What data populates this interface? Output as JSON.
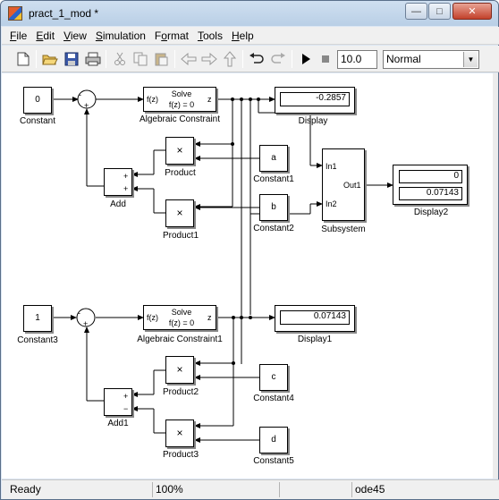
{
  "window": {
    "title": "pract_1_mod *",
    "minimize": "—",
    "maximize": "□",
    "close": "✕"
  },
  "menu": [
    {
      "label": "File",
      "key": "F",
      "rest": "ile"
    },
    {
      "label": "Edit",
      "key": "E",
      "rest": "dit"
    },
    {
      "label": "View",
      "key": "V",
      "rest": "iew"
    },
    {
      "label": "Simulation",
      "key": "S",
      "rest": "imulation"
    },
    {
      "label": "Format",
      "key": "o",
      "pre": "F",
      "rest": "rmat"
    },
    {
      "label": "Tools",
      "key": "T",
      "rest": "ools"
    },
    {
      "label": "Help",
      "key": "H",
      "rest": "elp"
    }
  ],
  "toolbar": {
    "icons": [
      "new-icon",
      "open-icon",
      "save-icon",
      "print-icon",
      "cut-icon",
      "copy-icon",
      "paste-icon",
      "back-icon",
      "forward-icon",
      "up-icon",
      "undo-icon",
      "redo-icon",
      "start-simulation-icon",
      "stop-simulation-icon"
    ],
    "stop_time": "10.0",
    "sim_mode": "Normal"
  },
  "diagram": {
    "constant": {
      "value": "0",
      "label": "Constant"
    },
    "constant1": {
      "value": "a",
      "label": "Constant1"
    },
    "constant2": {
      "value": "b",
      "label": "Constant2"
    },
    "constant3": {
      "value": "1",
      "label": "Constant3"
    },
    "constant4": {
      "value": "c",
      "label": "Constant4"
    },
    "constant5": {
      "value": "d",
      "label": "Constant5"
    },
    "sum1_signs": {
      "top": "-",
      "bottom": "+"
    },
    "sum2_signs": {
      "top": "-",
      "bottom": "+"
    },
    "alg1": {
      "fz": "f(z)",
      "solve": "Solve",
      "eq": "f(z) = 0",
      "out": "z",
      "label": "Algebraic Constraint"
    },
    "alg2": {
      "fz": "f(z)",
      "solve": "Solve",
      "eq": "f(z) = 0",
      "out": "z",
      "label": "Algebraic Constraint1"
    },
    "display": {
      "value": "-0.2857",
      "label": "Display"
    },
    "display1": {
      "value": "0.07143",
      "label": "Display1"
    },
    "display2": {
      "value1": "0",
      "value2": "0.07143",
      "label": "Display2"
    },
    "product": {
      "symbol": "×",
      "label": "Product"
    },
    "product1": {
      "symbol": "×",
      "label": "Product1"
    },
    "product2": {
      "symbol": "×",
      "label": "Product2"
    },
    "product3": {
      "symbol": "×",
      "label": "Product3"
    },
    "add": {
      "sign1": "+",
      "sign2": "+",
      "label": "Add"
    },
    "add1": {
      "sign1": "+",
      "sign2": "−",
      "label": "Add1"
    },
    "subsystem": {
      "in1": "In1",
      "in2": "In2",
      "out1": "Out1",
      "label": "Subsystem"
    }
  },
  "status": {
    "state": "Ready",
    "zoom": "100%",
    "solver": "ode45"
  }
}
